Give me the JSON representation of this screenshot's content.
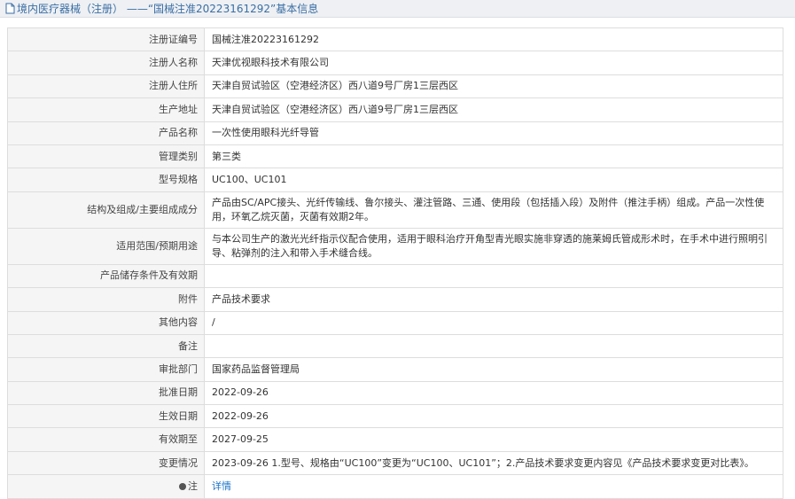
{
  "header": {
    "title": "境内医疗器械（注册） ——“国械注准20223161292”基本信息",
    "icon": "document-icon"
  },
  "rows": [
    {
      "label": "注册证编号",
      "value": "国械注准20223161292"
    },
    {
      "label": "注册人名称",
      "value": "天津优视眼科技术有限公司"
    },
    {
      "label": "注册人住所",
      "value": "天津自贸试验区（空港经济区）西八道9号厂房1三层西区"
    },
    {
      "label": "生产地址",
      "value": "天津自贸试验区（空港经济区）西八道9号厂房1三层西区"
    },
    {
      "label": "产品名称",
      "value": "一次性使用眼科光纤导管"
    },
    {
      "label": "管理类别",
      "value": "第三类"
    },
    {
      "label": "型号规格",
      "value": "UC100、UC101"
    },
    {
      "label": "结构及组成/主要组成成分",
      "value": "产品由SC/APC接头、光纤传输线、鲁尔接头、灌注管路、三通、使用段（包括插入段）及附件（推注手柄）组成。产品一次性使用，环氧乙烷灭菌，灭菌有效期2年。"
    },
    {
      "label": "适用范围/预期用途",
      "value": "与本公司生产的激光光纤指示仪配合使用，适用于眼科治疗开角型青光眼实施非穿透的施莱姆氏管成形术时，在手术中进行照明引导、粘弹剂的注入和带入手术缝合线。"
    },
    {
      "label": "产品储存条件及有效期",
      "value": ""
    },
    {
      "label": "附件",
      "value": "产品技术要求"
    },
    {
      "label": "其他内容",
      "value": "/"
    },
    {
      "label": "备注",
      "value": ""
    },
    {
      "label": "审批部门",
      "value": "国家药品监督管理局"
    },
    {
      "label": "批准日期",
      "value": "2022-09-26"
    },
    {
      "label": "生效日期",
      "value": "2022-09-26"
    },
    {
      "label": "有效期至",
      "value": "2027-09-25"
    },
    {
      "label": "变更情况",
      "value": "2023-09-26 1.型号、规格由“UC100”变更为“UC100、UC101”；2.产品技术要求变更内容见《产品技术要求变更对比表》。"
    }
  ],
  "note_row": {
    "label": "注",
    "link_text": "详情",
    "icon": "note-icon"
  },
  "colors": {
    "link": "#1a73c8",
    "title": "#3a6ea5",
    "label_bg": "#f5f5f5",
    "border": "#dddddd"
  }
}
